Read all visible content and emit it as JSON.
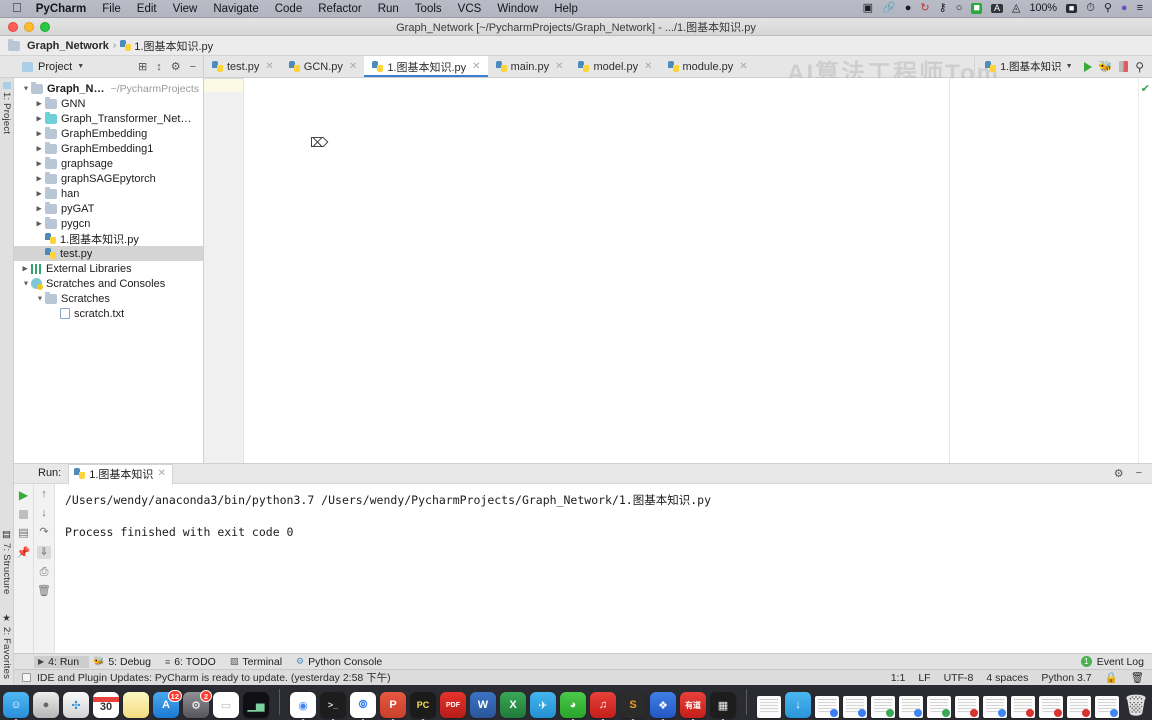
{
  "macos_menubar": {
    "apple_icon": "apple-logo",
    "items": [
      "PyCharm",
      "File",
      "Edit",
      "View",
      "Navigate",
      "Code",
      "Refactor",
      "Run",
      "Tools",
      "VCS",
      "Window",
      "Help"
    ],
    "app_name": "PyCharm",
    "status_icons": [
      "video-camera-icon",
      "link-chain-icon",
      "shield-icon",
      "refresh-sync-icon",
      "screenshot-icon",
      "bluetooth-icon",
      "greenshot-icon",
      "input-source-a-icon",
      "wifi-icon"
    ],
    "battery_percent": "100%",
    "battery_icon": "battery-icon",
    "clock_icon": "clock-icon",
    "spotlight_icon": "search-icon",
    "siri_icon": "siri-icon",
    "control_center_icon": "list-icon"
  },
  "window": {
    "title": "Graph_Network [~/PycharmProjects/Graph_Network] - .../1.图基本知识.py",
    "traffic_lights": [
      "close",
      "minimize",
      "maximize"
    ]
  },
  "breadcrumb": {
    "project": "Graph_Network",
    "separator": "›",
    "file": "1.图基本知识.py"
  },
  "watermark": "AI算法工程师Tom",
  "project_panel": {
    "header_label": "Project",
    "header_dropdown_icon": "chevron-down-icon",
    "toolbar_icons": [
      "target-locate-icon",
      "collapse-all-icon",
      "settings-gear-icon",
      "hide-minus-icon"
    ],
    "tree": [
      {
        "label": "Graph_Network",
        "path": "~/PycharmProjects",
        "depth": 0,
        "twisty": "down",
        "icon": "folder",
        "bold": true
      },
      {
        "label": "GNN",
        "depth": 1,
        "twisty": "right",
        "icon": "folder"
      },
      {
        "label": "Graph_Transformer_Networks",
        "depth": 1,
        "twisty": "right",
        "icon": "folder-teal"
      },
      {
        "label": "GraphEmbedding",
        "depth": 1,
        "twisty": "right",
        "icon": "folder"
      },
      {
        "label": "GraphEmbedding1",
        "depth": 1,
        "twisty": "right",
        "icon": "folder"
      },
      {
        "label": "graphsage",
        "depth": 1,
        "twisty": "right",
        "icon": "folder"
      },
      {
        "label": "graphSAGEpytorch",
        "depth": 1,
        "twisty": "right",
        "icon": "folder"
      },
      {
        "label": "han",
        "depth": 1,
        "twisty": "right",
        "icon": "folder"
      },
      {
        "label": "pyGAT",
        "depth": 1,
        "twisty": "right",
        "icon": "folder"
      },
      {
        "label": "pygcn",
        "depth": 1,
        "twisty": "right",
        "icon": "folder"
      },
      {
        "label": "1.图基本知识.py",
        "depth": 1,
        "twisty": "none",
        "icon": "python-run"
      },
      {
        "label": "test.py",
        "depth": 1,
        "twisty": "none",
        "icon": "python",
        "selected": true
      },
      {
        "label": "External Libraries",
        "depth": 0,
        "twisty": "right",
        "icon": "library"
      },
      {
        "label": "Scratches and Consoles",
        "depth": 0,
        "twisty": "down",
        "icon": "scratch"
      },
      {
        "label": "Scratches",
        "depth": 1,
        "twisty": "down",
        "icon": "folder"
      },
      {
        "label": "scratch.txt",
        "depth": 2,
        "twisty": "none",
        "icon": "textfile"
      }
    ]
  },
  "left_strip": {
    "top_label": "1: Project",
    "structure_label": "7: Structure",
    "favorites_label": "2: Favorites",
    "star_icon": "star-icon"
  },
  "editor_tabs": [
    {
      "label": "test.py",
      "icon": "python-icon",
      "active": false
    },
    {
      "label": "GCN.py",
      "icon": "python-icon",
      "active": false
    },
    {
      "label": "1.图基本知识.py",
      "icon": "python-run-icon",
      "active": true
    },
    {
      "label": "main.py",
      "icon": "python-icon",
      "active": false
    },
    {
      "label": "model.py",
      "icon": "python-icon",
      "active": false
    },
    {
      "label": "module.py",
      "icon": "python-icon",
      "active": false
    }
  ],
  "run_config": {
    "name": "1.图基本知识",
    "dropdown_icon": "chevron-down-icon",
    "run_icon": "run-triangle-icon",
    "debug_icon": "debug-bug-icon",
    "coverage_icon": "coverage-icon",
    "search_icon": "search-icon"
  },
  "editor": {
    "content": "",
    "caret_icon": "text-cursor-icon",
    "inspection_status_icon": "checkmark-ok-icon"
  },
  "run_panel": {
    "title": "Run:",
    "tab_label": "1.图基本知识",
    "tab_icon": "python-icon",
    "tab_close_icon": "close-icon",
    "settings_icon": "settings-gear-icon",
    "hide_icon": "hide-minus-icon",
    "left_tools": [
      "rerun-run-icon",
      "stop-icon",
      "console-icon",
      "pin-icon"
    ],
    "right_tools": [
      "scroll-up-icon",
      "scroll-down-icon",
      "soft-wrap-icon",
      "scroll-to-end-icon",
      "print-icon",
      "clear-all-icon"
    ],
    "console_lines": [
      "/Users/wendy/anaconda3/bin/python3.7 /Users/wendy/PycharmProjects/Graph_Network/1.图基本知识.py",
      "",
      "Process finished with exit code 0"
    ]
  },
  "bottom_bar": {
    "items": [
      {
        "label": "4: Run",
        "icon": "run-triangle-icon",
        "active": true
      },
      {
        "label": "5: Debug",
        "icon": "debug-bug-icon",
        "active": false
      },
      {
        "label": "6: TODO",
        "icon": "todo-list-icon",
        "active": false
      },
      {
        "label": "Terminal",
        "icon": "terminal-icon",
        "active": false
      },
      {
        "label": "Python Console",
        "icon": "python-console-icon",
        "active": false
      }
    ],
    "event_log_label": "Event Log",
    "event_log_count": "1"
  },
  "status_bar": {
    "message": "IDE and Plugin Updates: PyCharm is ready to update. (yesterday 2:58 下午)",
    "caret_position": "1:1",
    "line_separator": "LF",
    "encoding": "UTF-8",
    "indent": "4 spaces",
    "interpreter": "Python 3.7",
    "lock_icon": "lock-icon",
    "trash_icon": "trash-icon"
  },
  "dock": {
    "apps": [
      {
        "name": "finder",
        "glyph": "☺",
        "bg": "linear-gradient(#4fb7f5,#2a8fd8)",
        "running": true
      },
      {
        "name": "launchpad",
        "glyph": "🚀",
        "bg": "linear-gradient(#e4e4e4,#b6b6b6)",
        "running": false
      },
      {
        "name": "safari",
        "glyph": "🧭",
        "bg": "linear-gradient(#f2f2f2,#cfcfcf)",
        "running": false
      },
      {
        "name": "calendar",
        "glyph": "30",
        "bg": "#ffffff",
        "running": false
      },
      {
        "name": "notes",
        "glyph": "",
        "bg": "linear-gradient(#fdf6c2,#f5e48a)",
        "running": false
      },
      {
        "name": "app-store",
        "glyph": "A",
        "bg": "linear-gradient(#4aa8f0,#1a7ad4)",
        "running": false,
        "badge": "12"
      },
      {
        "name": "system-preferences",
        "glyph": "⚙",
        "bg": "linear-gradient(#8f8f95,#5d5d63)",
        "running": false,
        "badge": "2"
      },
      {
        "name": "pages",
        "glyph": "",
        "bg": "#ffffff",
        "running": false
      },
      {
        "name": "activity-monitor",
        "glyph": "",
        "bg": "#111111",
        "running": false
      }
    ],
    "apps2": [
      {
        "name": "google-chrome",
        "glyph": "◉",
        "bg": "#ffffff",
        "running": true
      },
      {
        "name": "iterm-terminal",
        "glyph": "›_",
        "bg": "#1d1d1d",
        "running": true
      },
      {
        "name": "tencent-meeting",
        "glyph": "",
        "bg": "#ffffff",
        "running": true
      },
      {
        "name": "powerpoint",
        "glyph": "P",
        "bg": "linear-gradient(#e8573f,#c8402c)",
        "running": true
      },
      {
        "name": "pycharm",
        "glyph": "PC",
        "bg": "#1b1b1b",
        "running": true
      },
      {
        "name": "pdf-reader",
        "glyph": "PDF",
        "bg": "linear-gradient(#e8332c,#b51d18)",
        "running": false
      },
      {
        "name": "microsoft-word",
        "glyph": "W",
        "bg": "linear-gradient(#3b73c4,#2a5699)",
        "running": false
      },
      {
        "name": "microsoft-excel",
        "glyph": "X",
        "bg": "linear-gradient(#3aa856,#1f7a3a)",
        "running": false
      },
      {
        "name": "telegram",
        "glyph": "✈",
        "bg": "linear-gradient(#43b5ef,#2490d0)",
        "running": false
      },
      {
        "name": "wechat",
        "glyph": "💬",
        "bg": "linear-gradient(#4bc94b,#2aa42a)",
        "running": true
      },
      {
        "name": "netease-music",
        "glyph": "♪",
        "bg": "linear-gradient(#e8403a,#c41f1a)",
        "running": true
      },
      {
        "name": "sublime-text",
        "glyph": "S",
        "bg": "#2b2b2b",
        "running": true
      },
      {
        "name": "feishu",
        "glyph": "✦",
        "bg": "linear-gradient(#3f7fe8,#2457c4)",
        "running": true
      },
      {
        "name": "youdao-dict",
        "glyph": "有道",
        "bg": "linear-gradient(#e8403a,#c41f1a)",
        "running": true
      },
      {
        "name": "quicktime-camera",
        "glyph": "▭",
        "bg": "#1d1d1d",
        "running": true
      }
    ],
    "minimized": [
      {
        "name": "document-window-1",
        "corner": "none"
      },
      {
        "name": "downloads-folder",
        "corner": "blue"
      },
      {
        "name": "document-window-2",
        "corner": "blue"
      },
      {
        "name": "document-window-3",
        "corner": "blue"
      },
      {
        "name": "document-window-4",
        "corner": "green"
      },
      {
        "name": "document-window-5",
        "corner": "chrome"
      },
      {
        "name": "document-window-6",
        "corner": "green"
      },
      {
        "name": "document-window-7",
        "corner": "red"
      },
      {
        "name": "document-window-8",
        "corner": "chrome"
      },
      {
        "name": "document-window-9",
        "corner": "red"
      },
      {
        "name": "document-window-10",
        "corner": "red"
      },
      {
        "name": "document-window-11",
        "corner": "red"
      },
      {
        "name": "document-window-12",
        "corner": "chrome"
      }
    ],
    "trash_icon": "trash-icon"
  }
}
